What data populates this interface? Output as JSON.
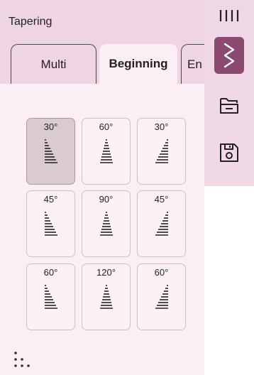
{
  "panel": {
    "title": "Tapering"
  },
  "tabs": [
    {
      "label": "Multi",
      "active": false
    },
    {
      "label": "Beginning",
      "active": true
    },
    {
      "label": "En",
      "active": false
    }
  ],
  "tiles": [
    {
      "angle": "30°",
      "shape": "left",
      "selected": true
    },
    {
      "angle": "60°",
      "shape": "center",
      "selected": false
    },
    {
      "angle": "30°",
      "shape": "right",
      "selected": false
    },
    {
      "angle": "45°",
      "shape": "left",
      "selected": false
    },
    {
      "angle": "90°",
      "shape": "center",
      "selected": false
    },
    {
      "angle": "45°",
      "shape": "right",
      "selected": false
    },
    {
      "angle": "60°",
      "shape": "left",
      "selected": false
    },
    {
      "angle": "120°",
      "shape": "center",
      "selected": false
    },
    {
      "angle": "60°",
      "shape": "right",
      "selected": false
    }
  ],
  "toolbar": {
    "icons": [
      "grip-lines-icon",
      "zigzag-stitch-icon",
      "folder-icon",
      "save-icon"
    ],
    "active_icon": "zigzag-stitch-icon"
  },
  "colors": {
    "accent": "#8c4a70",
    "header_bg": "#efd4e3",
    "panel_bg": "#fbeef5",
    "tile_selected": "#dacbd3"
  }
}
